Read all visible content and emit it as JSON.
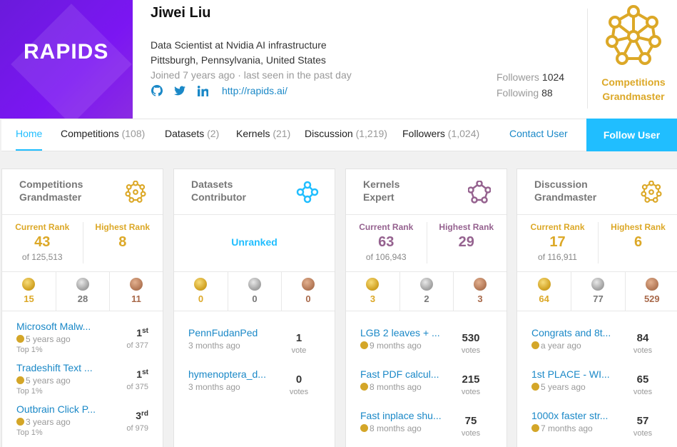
{
  "profile": {
    "banner_text": "RAPIDS",
    "name": "Jiwei Liu",
    "occupation": "Data Scientist at Nvidia AI infrastructure",
    "location": "Pittsburgh, Pennsylvania, United States",
    "joined": "Joined 7 years ago · last seen in the past day",
    "website": "http://rapids.ai/",
    "followers_label": "Followers",
    "followers_value": "1024",
    "following_label": "Following",
    "following_value": "88",
    "tier_line1": "Competitions",
    "tier_line2": "Grandmaster"
  },
  "nav": {
    "tabs": [
      {
        "label": "Home",
        "count": ""
      },
      {
        "label": "Competitions",
        "count": "(108)"
      },
      {
        "label": "Datasets",
        "count": "(2)"
      },
      {
        "label": "Kernels",
        "count": "(21)"
      },
      {
        "label": "Discussion",
        "count": "(1,219)"
      },
      {
        "label": "Followers",
        "count": "(1,024)"
      }
    ],
    "contact": "Contact User",
    "follow": "Follow User"
  },
  "colors": {
    "accent": "#20beff",
    "gold": "#dca827",
    "kernels": "#95628f",
    "link": "#1a88c7",
    "banner": "#7b16f2"
  },
  "cards": [
    {
      "title1": "Competitions",
      "title2": "Grandmaster",
      "icon": "grandmaster-icon",
      "current_label": "Current Rank",
      "current": "43",
      "of": "of 125,513",
      "highest_label": "Highest Rank",
      "highest": "8",
      "gold": "15",
      "silver": "28",
      "bronze": "11",
      "items": [
        {
          "name": "Microsoft Malw...",
          "ago": "5 years ago",
          "top": "Top 1%",
          "place": "1",
          "suffix": "st",
          "of": "of 377"
        },
        {
          "name": "Tradeshift Text ...",
          "ago": "5 years ago",
          "top": "Top 1%",
          "place": "1",
          "suffix": "st",
          "of": "of 375"
        },
        {
          "name": "Outbrain Click P...",
          "ago": "3 years ago",
          "top": "Top 1%",
          "place": "3",
          "suffix": "rd",
          "of": "of 979"
        }
      ]
    },
    {
      "title1": "Datasets",
      "title2": "Contributor",
      "icon": "contributor-icon",
      "unranked": "Unranked",
      "gold": "0",
      "silver": "0",
      "bronze": "0",
      "items": [
        {
          "name": "PennFudanPed",
          "ago": "3 months ago",
          "votes": "1",
          "vote_label": "vote"
        },
        {
          "name": "hymenoptera_d...",
          "ago": "3 months ago",
          "votes": "0",
          "vote_label": "votes"
        }
      ]
    },
    {
      "title1": "Kernels",
      "title2": "Expert",
      "icon": "expert-icon",
      "current_label": "Current Rank",
      "current": "63",
      "of": "of 106,943",
      "highest_label": "Highest Rank",
      "highest": "29",
      "gold": "3",
      "silver": "2",
      "bronze": "3",
      "items": [
        {
          "name": "LGB 2 leaves + ...",
          "ago": "9 months ago",
          "votes": "530",
          "vote_label": "votes"
        },
        {
          "name": "Fast PDF calcul...",
          "ago": "8 months ago",
          "votes": "215",
          "vote_label": "votes"
        },
        {
          "name": "Fast inplace shu...",
          "ago": "8 months ago",
          "votes": "75",
          "vote_label": "votes"
        }
      ]
    },
    {
      "title1": "Discussion",
      "title2": "Grandmaster",
      "icon": "grandmaster-icon",
      "current_label": "Current Rank",
      "current": "17",
      "of": "of 116,911",
      "highest_label": "Highest Rank",
      "highest": "6",
      "gold": "64",
      "silver": "77",
      "bronze": "529",
      "items": [
        {
          "name": "Congrats and 8t...",
          "ago": "a year ago",
          "votes": "84",
          "vote_label": "votes"
        },
        {
          "name": "1st PLACE - WI...",
          "ago": "5 years ago",
          "votes": "65",
          "vote_label": "votes"
        },
        {
          "name": "1000x faster str...",
          "ago": "7 months ago",
          "votes": "57",
          "vote_label": "votes"
        }
      ]
    }
  ]
}
